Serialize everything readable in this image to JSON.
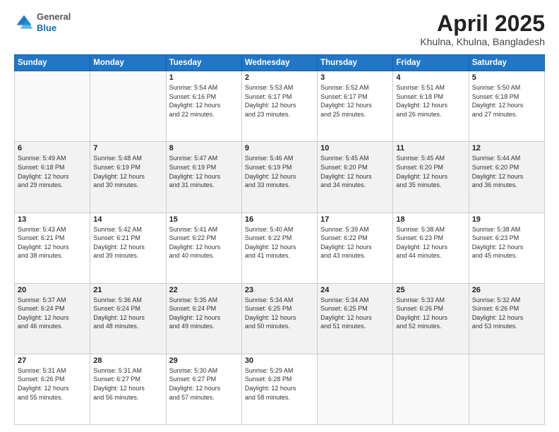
{
  "header": {
    "logo_general": "General",
    "logo_blue": "Blue",
    "title": "April 2025",
    "location": "Khulna, Khulna, Bangladesh"
  },
  "days_of_week": [
    "Sunday",
    "Monday",
    "Tuesday",
    "Wednesday",
    "Thursday",
    "Friday",
    "Saturday"
  ],
  "weeks": [
    [
      {
        "day": "",
        "lines": []
      },
      {
        "day": "",
        "lines": []
      },
      {
        "day": "1",
        "lines": [
          "Sunrise: 5:54 AM",
          "Sunset: 6:16 PM",
          "Daylight: 12 hours",
          "and 22 minutes."
        ]
      },
      {
        "day": "2",
        "lines": [
          "Sunrise: 5:53 AM",
          "Sunset: 6:17 PM",
          "Daylight: 12 hours",
          "and 23 minutes."
        ]
      },
      {
        "day": "3",
        "lines": [
          "Sunrise: 5:52 AM",
          "Sunset: 6:17 PM",
          "Daylight: 12 hours",
          "and 25 minutes."
        ]
      },
      {
        "day": "4",
        "lines": [
          "Sunrise: 5:51 AM",
          "Sunset: 6:18 PM",
          "Daylight: 12 hours",
          "and 26 minutes."
        ]
      },
      {
        "day": "5",
        "lines": [
          "Sunrise: 5:50 AM",
          "Sunset: 6:18 PM",
          "Daylight: 12 hours",
          "and 27 minutes."
        ]
      }
    ],
    [
      {
        "day": "6",
        "lines": [
          "Sunrise: 5:49 AM",
          "Sunset: 6:18 PM",
          "Daylight: 12 hours",
          "and 29 minutes."
        ]
      },
      {
        "day": "7",
        "lines": [
          "Sunrise: 5:48 AM",
          "Sunset: 6:19 PM",
          "Daylight: 12 hours",
          "and 30 minutes."
        ]
      },
      {
        "day": "8",
        "lines": [
          "Sunrise: 5:47 AM",
          "Sunset: 6:19 PM",
          "Daylight: 12 hours",
          "and 31 minutes."
        ]
      },
      {
        "day": "9",
        "lines": [
          "Sunrise: 5:46 AM",
          "Sunset: 6:19 PM",
          "Daylight: 12 hours",
          "and 33 minutes."
        ]
      },
      {
        "day": "10",
        "lines": [
          "Sunrise: 5:45 AM",
          "Sunset: 6:20 PM",
          "Daylight: 12 hours",
          "and 34 minutes."
        ]
      },
      {
        "day": "11",
        "lines": [
          "Sunrise: 5:45 AM",
          "Sunset: 6:20 PM",
          "Daylight: 12 hours",
          "and 35 minutes."
        ]
      },
      {
        "day": "12",
        "lines": [
          "Sunrise: 5:44 AM",
          "Sunset: 6:20 PM",
          "Daylight: 12 hours",
          "and 36 minutes."
        ]
      }
    ],
    [
      {
        "day": "13",
        "lines": [
          "Sunrise: 5:43 AM",
          "Sunset: 6:21 PM",
          "Daylight: 12 hours",
          "and 38 minutes."
        ]
      },
      {
        "day": "14",
        "lines": [
          "Sunrise: 5:42 AM",
          "Sunset: 6:21 PM",
          "Daylight: 12 hours",
          "and 39 minutes."
        ]
      },
      {
        "day": "15",
        "lines": [
          "Sunrise: 5:41 AM",
          "Sunset: 6:22 PM",
          "Daylight: 12 hours",
          "and 40 minutes."
        ]
      },
      {
        "day": "16",
        "lines": [
          "Sunrise: 5:40 AM",
          "Sunset: 6:22 PM",
          "Daylight: 12 hours",
          "and 41 minutes."
        ]
      },
      {
        "day": "17",
        "lines": [
          "Sunrise: 5:39 AM",
          "Sunset: 6:22 PM",
          "Daylight: 12 hours",
          "and 43 minutes."
        ]
      },
      {
        "day": "18",
        "lines": [
          "Sunrise: 5:38 AM",
          "Sunset: 6:23 PM",
          "Daylight: 12 hours",
          "and 44 minutes."
        ]
      },
      {
        "day": "19",
        "lines": [
          "Sunrise: 5:38 AM",
          "Sunset: 6:23 PM",
          "Daylight: 12 hours",
          "and 45 minutes."
        ]
      }
    ],
    [
      {
        "day": "20",
        "lines": [
          "Sunrise: 5:37 AM",
          "Sunset: 6:24 PM",
          "Daylight: 12 hours",
          "and 46 minutes."
        ]
      },
      {
        "day": "21",
        "lines": [
          "Sunrise: 5:36 AM",
          "Sunset: 6:24 PM",
          "Daylight: 12 hours",
          "and 48 minutes."
        ]
      },
      {
        "day": "22",
        "lines": [
          "Sunrise: 5:35 AM",
          "Sunset: 6:24 PM",
          "Daylight: 12 hours",
          "and 49 minutes."
        ]
      },
      {
        "day": "23",
        "lines": [
          "Sunrise: 5:34 AM",
          "Sunset: 6:25 PM",
          "Daylight: 12 hours",
          "and 50 minutes."
        ]
      },
      {
        "day": "24",
        "lines": [
          "Sunrise: 5:34 AM",
          "Sunset: 6:25 PM",
          "Daylight: 12 hours",
          "and 51 minutes."
        ]
      },
      {
        "day": "25",
        "lines": [
          "Sunrise: 5:33 AM",
          "Sunset: 6:26 PM",
          "Daylight: 12 hours",
          "and 52 minutes."
        ]
      },
      {
        "day": "26",
        "lines": [
          "Sunrise: 5:32 AM",
          "Sunset: 6:26 PM",
          "Daylight: 12 hours",
          "and 53 minutes."
        ]
      }
    ],
    [
      {
        "day": "27",
        "lines": [
          "Sunrise: 5:31 AM",
          "Sunset: 6:26 PM",
          "Daylight: 12 hours",
          "and 55 minutes."
        ]
      },
      {
        "day": "28",
        "lines": [
          "Sunrise: 5:31 AM",
          "Sunset: 6:27 PM",
          "Daylight: 12 hours",
          "and 56 minutes."
        ]
      },
      {
        "day": "29",
        "lines": [
          "Sunrise: 5:30 AM",
          "Sunset: 6:27 PM",
          "Daylight: 12 hours",
          "and 57 minutes."
        ]
      },
      {
        "day": "30",
        "lines": [
          "Sunrise: 5:29 AM",
          "Sunset: 6:28 PM",
          "Daylight: 12 hours",
          "and 58 minutes."
        ]
      },
      {
        "day": "",
        "lines": []
      },
      {
        "day": "",
        "lines": []
      },
      {
        "day": "",
        "lines": []
      }
    ]
  ]
}
